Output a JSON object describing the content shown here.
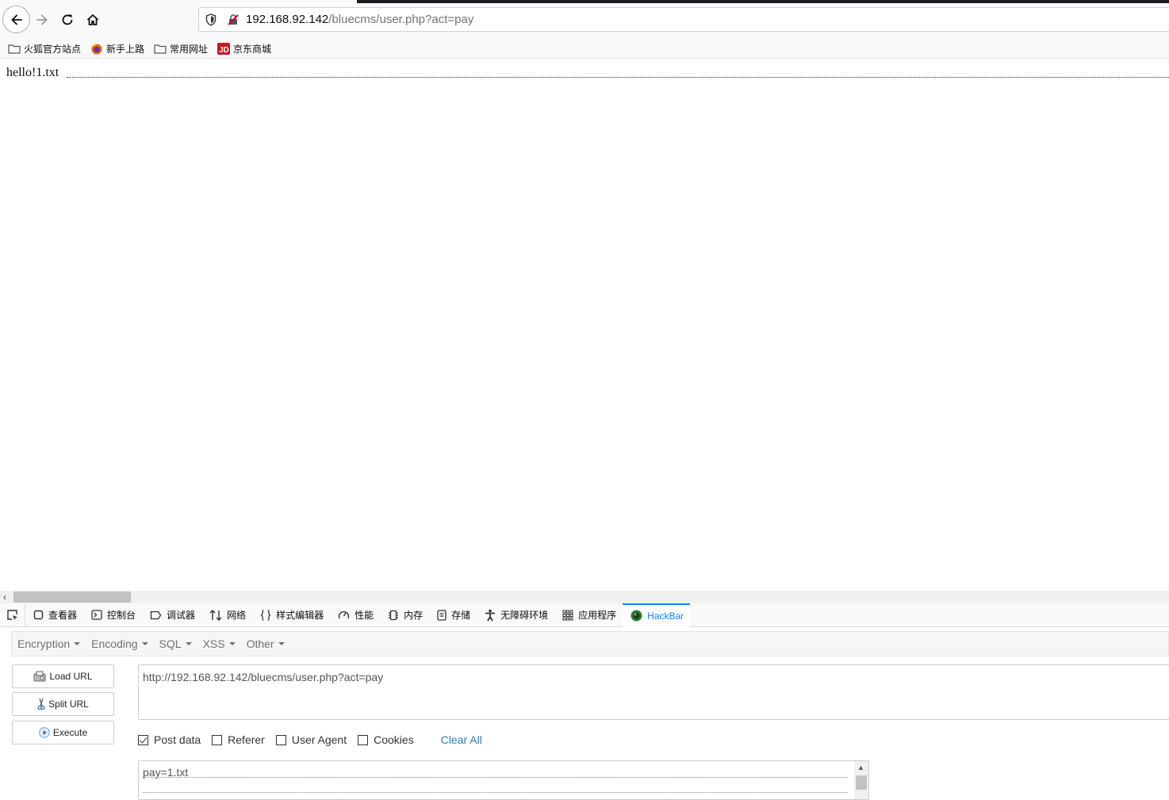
{
  "browser": {
    "url_host": "192.168.92.142",
    "url_path": "/bluecms/user.php?act=pay"
  },
  "bookmarks": [
    {
      "label": "火狐官方站点",
      "icon": "folder-icon"
    },
    {
      "label": "新手上路",
      "icon": "firefox-icon"
    },
    {
      "label": "常用网址",
      "icon": "folder-icon"
    },
    {
      "label": "京东商城",
      "icon": "jd-icon"
    }
  ],
  "page": {
    "output_text": "hello!1.txt"
  },
  "devtools": {
    "tabs": [
      {
        "label": "查看器",
        "icon": "inspector-icon"
      },
      {
        "label": "控制台",
        "icon": "console-icon"
      },
      {
        "label": "调试器",
        "icon": "debugger-icon"
      },
      {
        "label": "网络",
        "icon": "network-icon"
      },
      {
        "label": "样式编辑器",
        "icon": "style-editor-icon"
      },
      {
        "label": "性能",
        "icon": "performance-icon"
      },
      {
        "label": "内存",
        "icon": "memory-icon"
      },
      {
        "label": "存储",
        "icon": "storage-icon"
      },
      {
        "label": "无障碍环境",
        "icon": "accessibility-icon"
      },
      {
        "label": "应用程序",
        "icon": "application-icon"
      },
      {
        "label": "HackBar",
        "icon": "hackbar-icon",
        "active": true
      }
    ]
  },
  "hackbar": {
    "menu": [
      "Encryption",
      "Encoding",
      "SQL",
      "XSS",
      "Other"
    ],
    "buttons": {
      "load_url": "Load URL",
      "split_url": "Split URL",
      "execute": "Execute"
    },
    "url_value": "http://192.168.92.142/bluecms/user.php?act=pay",
    "options": {
      "post_data": {
        "label": "Post data",
        "checked": true
      },
      "referer": {
        "label": "Referer",
        "checked": false
      },
      "user_agent": {
        "label": "User Agent",
        "checked": false
      },
      "cookies": {
        "label": "Cookies",
        "checked": false
      },
      "clear_all": "Clear All"
    },
    "post_value": "pay=1.txt"
  },
  "colors": {
    "accent": "#0a84ff",
    "link": "#337ab7",
    "insecure": "#d70022"
  }
}
